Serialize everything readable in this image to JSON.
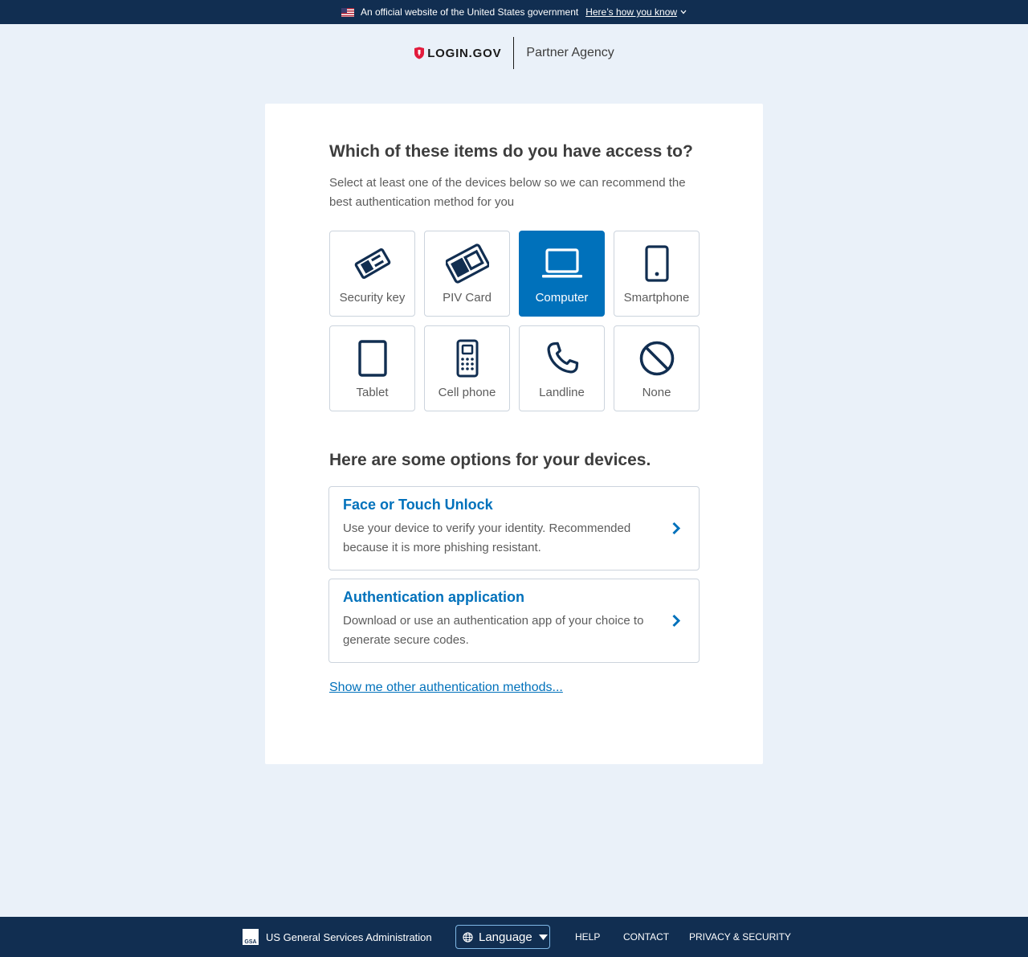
{
  "banner": {
    "text": "An official website of the United States government",
    "link": "Here’s how you know"
  },
  "header": {
    "logo": "LOGIN.GOV",
    "partner": "Partner Agency"
  },
  "question": {
    "title": "Which of these items do you have access to?",
    "subtitle": "Select at least one of the devices below so we can recommend the best authentication method for you"
  },
  "devices": [
    {
      "label": "Security key",
      "icon": "security-key-icon",
      "selected": false
    },
    {
      "label": "PIV Card",
      "icon": "piv-card-icon",
      "selected": false
    },
    {
      "label": "Computer",
      "icon": "laptop-icon",
      "selected": true
    },
    {
      "label": "Smartphone",
      "icon": "smartphone-icon",
      "selected": false
    },
    {
      "label": "Tablet",
      "icon": "tablet-icon",
      "selected": false
    },
    {
      "label": "Cell phone",
      "icon": "cell-phone-icon",
      "selected": false
    },
    {
      "label": "Landline",
      "icon": "phone-icon",
      "selected": false
    },
    {
      "label": "None",
      "icon": "none-icon",
      "selected": false
    }
  ],
  "options": {
    "title": "Here are some options for your devices.",
    "items": [
      {
        "title": "Face or Touch Unlock",
        "description": "Use your device to verify your identity. Recommended because it is more phishing resistant."
      },
      {
        "title": "Authentication application",
        "description": "Download or use an authentication app of your choice to generate secure codes."
      }
    ],
    "more_link": "Show me other authentication methods..."
  },
  "footer": {
    "agency": "US General Services Administration",
    "gsa_mark": "GSA",
    "language": "Language",
    "help": "HELP",
    "contact": "CONTACT",
    "privacy": "PRIVACY & SECURITY"
  },
  "colors": {
    "navy": "#112e51",
    "accent": "#0071bb",
    "page_bg": "#eaf1f9",
    "icon": "#112e51"
  }
}
